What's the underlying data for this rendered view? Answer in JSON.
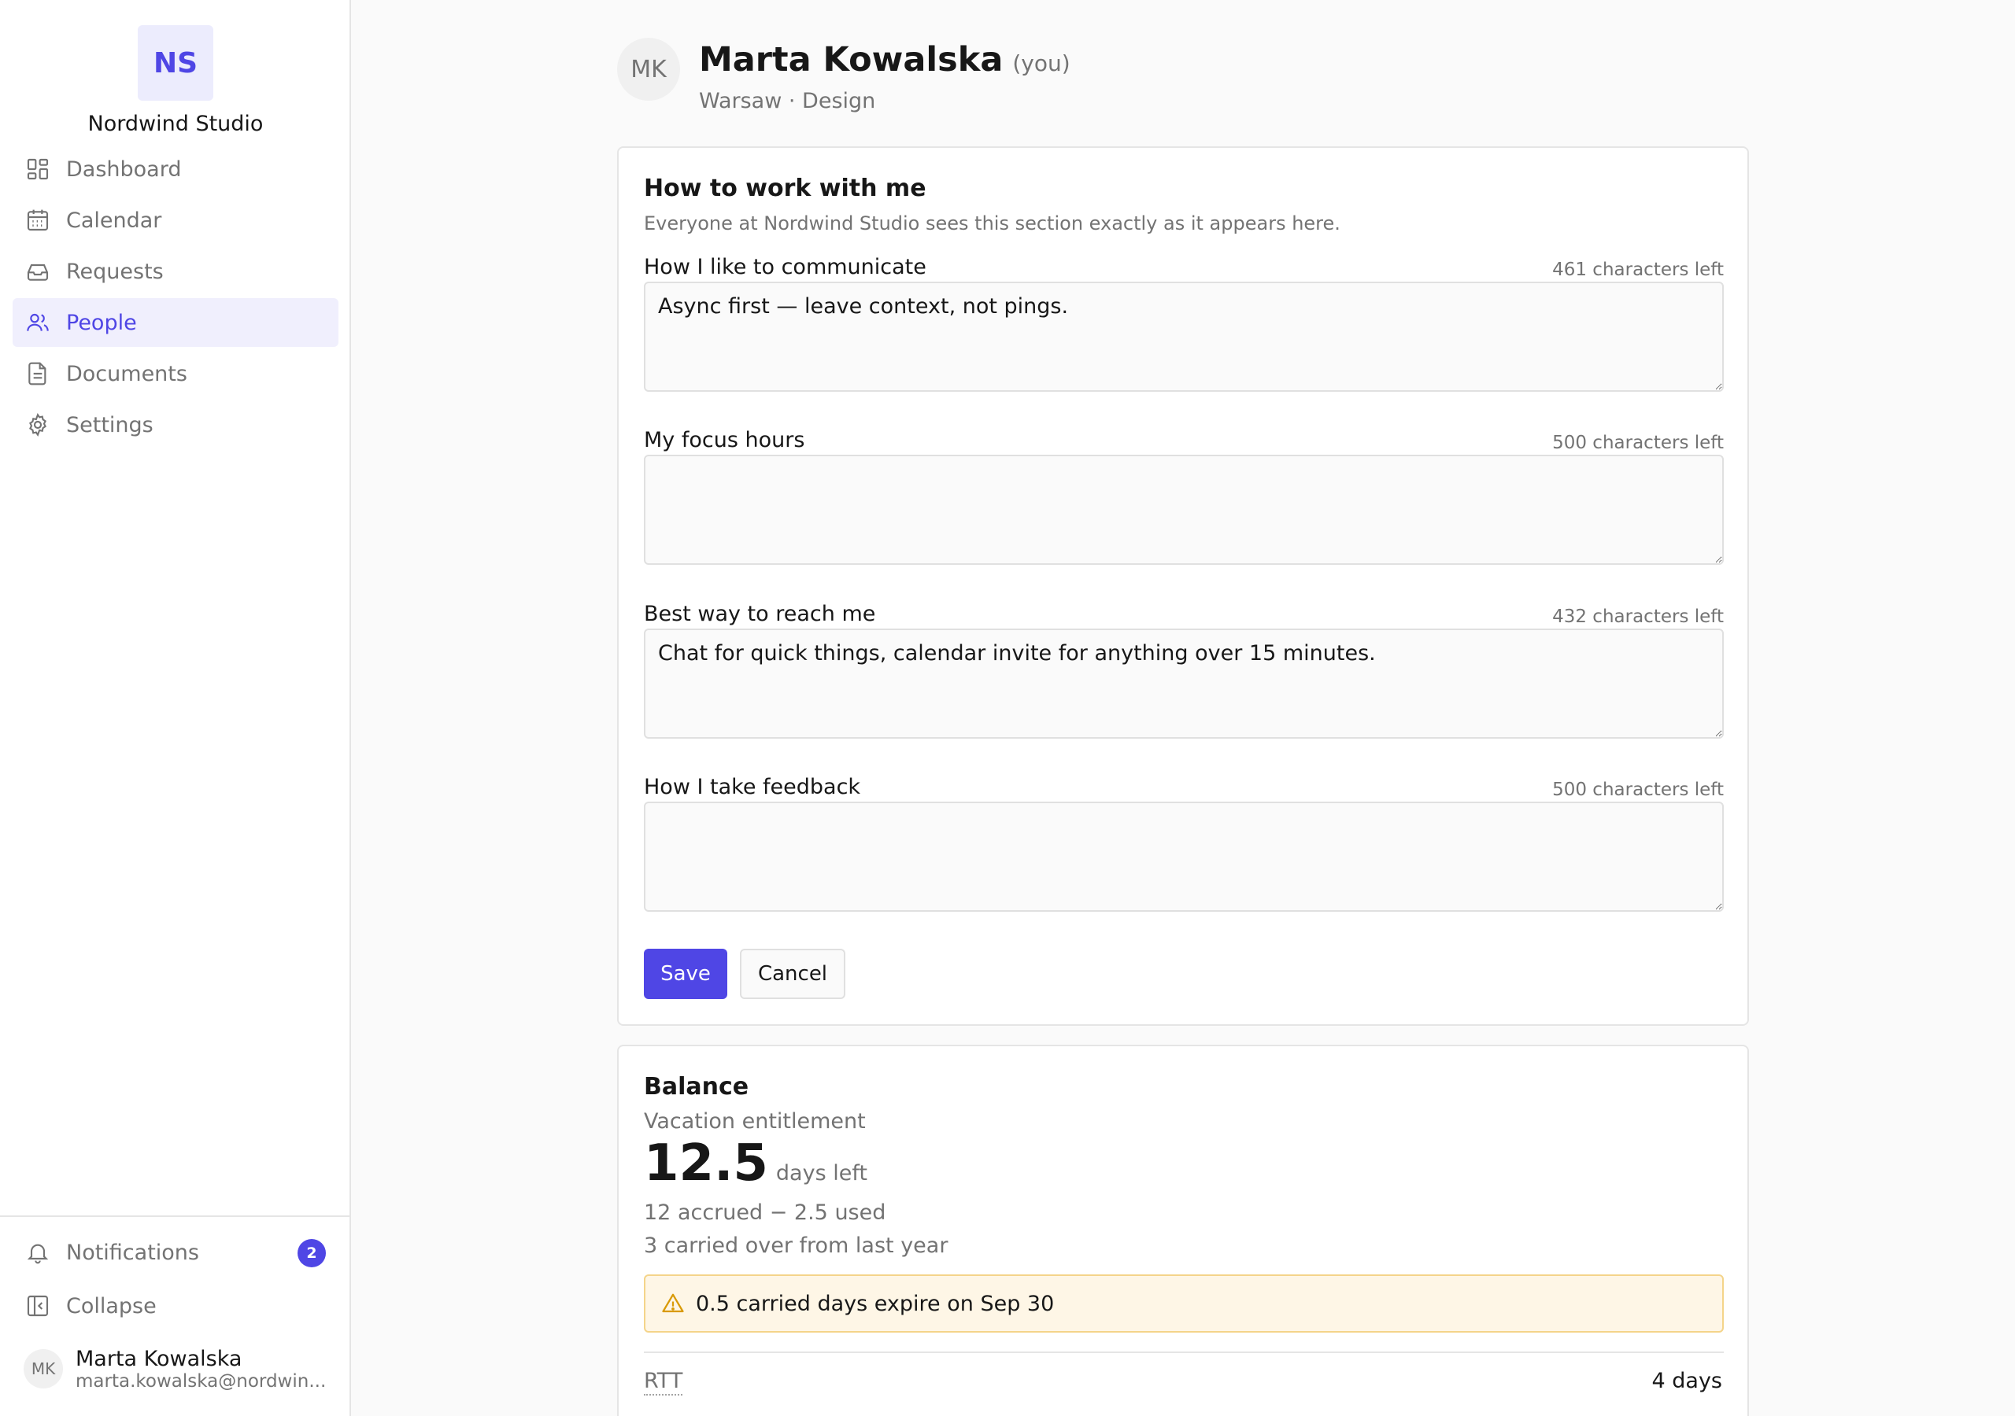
{
  "brand": {
    "initials": "NS",
    "name": "Nordwind Studio",
    "accent": "#4f46e5"
  },
  "nav": {
    "items": [
      {
        "label": "Dashboard",
        "icon": "dashboard-icon"
      },
      {
        "label": "Calendar",
        "icon": "calendar-icon"
      },
      {
        "label": "Requests",
        "icon": "inbox-icon"
      },
      {
        "label": "People",
        "icon": "people-icon",
        "active": true
      },
      {
        "label": "Documents",
        "icon": "document-icon"
      },
      {
        "label": "Settings",
        "icon": "gear-icon"
      }
    ]
  },
  "sidebar_bottom": {
    "notifications": {
      "label": "Notifications",
      "count": "2",
      "icon": "bell-icon"
    },
    "collapse": {
      "label": "Collapse",
      "icon": "collapse-icon"
    },
    "user": {
      "initials": "MK",
      "name": "Marta Kowalska",
      "email": "marta.kowalska@nordwin..."
    }
  },
  "profile": {
    "initials": "MK",
    "name": "Marta Kowalska",
    "you_tag": "(you)",
    "subtitle": "Warsaw · Design"
  },
  "work_with_me": {
    "title": "How to work with me",
    "description": "Everyone at Nordwind Studio sees this section exactly as it appears here.",
    "fields": [
      {
        "label": "How I like to communicate",
        "counter": "461 characters left",
        "value": "Async first — leave context, not pings."
      },
      {
        "label": "My focus hours",
        "counter": "500 characters left",
        "value": ""
      },
      {
        "label": "Best way to reach me",
        "counter": "432 characters left",
        "value": "Chat for quick things, calendar invite for anything over 15 minutes."
      },
      {
        "label": "How I take feedback",
        "counter": "500 characters left",
        "value": ""
      }
    ],
    "save_label": "Save",
    "cancel_label": "Cancel"
  },
  "balance": {
    "title": "Balance",
    "entitlement_label": "Vacation entitlement",
    "days_left_value": "12.5",
    "days_left_unit": "days left",
    "accrued_line": "12 accrued − 2.5 used",
    "carried_line": "3 carried over from last year",
    "warning": "0.5 carried days expire on Sep 30",
    "warning_color": "#d99a06",
    "rtt_label": "RTT",
    "rtt_value": "4 days"
  }
}
